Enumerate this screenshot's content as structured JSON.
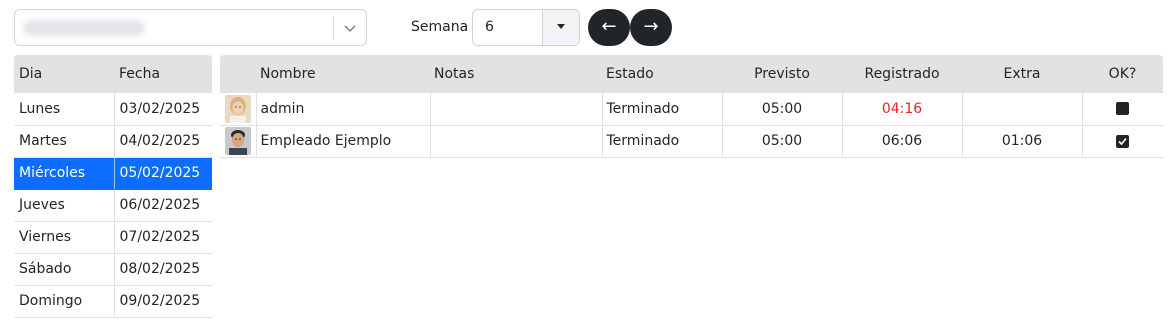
{
  "toolbar": {
    "combo_icon": "chevron-down-icon",
    "semana_label": "Semana",
    "semana_value": "6",
    "prev_label": "←",
    "next_label": "→"
  },
  "days": {
    "headers": [
      "Dia",
      "Fecha"
    ],
    "rows": [
      {
        "dia": "Lunes",
        "fecha": "03/02/2025"
      },
      {
        "dia": "Martes",
        "fecha": "04/02/2025"
      },
      {
        "dia": "Miércoles",
        "fecha": "05/02/2025"
      },
      {
        "dia": "Jueves",
        "fecha": "06/02/2025"
      },
      {
        "dia": "Viernes",
        "fecha": "07/02/2025"
      },
      {
        "dia": "Sábado",
        "fecha": "08/02/2025"
      },
      {
        "dia": "Domingo",
        "fecha": "09/02/2025"
      }
    ],
    "selected_day": "Miércoles"
  },
  "employees": {
    "headers": [
      "Nombre",
      "Notas",
      "Estado",
      "Previsto",
      "Registrado",
      "Extra",
      "OK?"
    ],
    "rows": [
      {
        "avatar": "avatar-woman",
        "nombre": "admin",
        "notas": "",
        "estado": "Terminado",
        "previsto": "05:00",
        "registrado": "04:16",
        "extra": "",
        "ok": false
      },
      {
        "avatar": "avatar-man",
        "nombre": "Empleado Ejemplo",
        "notas": "",
        "estado": "Terminado",
        "previsto": "05:00",
        "registrado": "06:06",
        "extra": "01:06",
        "ok": true
      }
    ]
  },
  "colors": {
    "selected_row": "#0d6efd",
    "header_bg": "#e2e2e2",
    "short_time": "#e02424",
    "nav_button": "#212529"
  }
}
